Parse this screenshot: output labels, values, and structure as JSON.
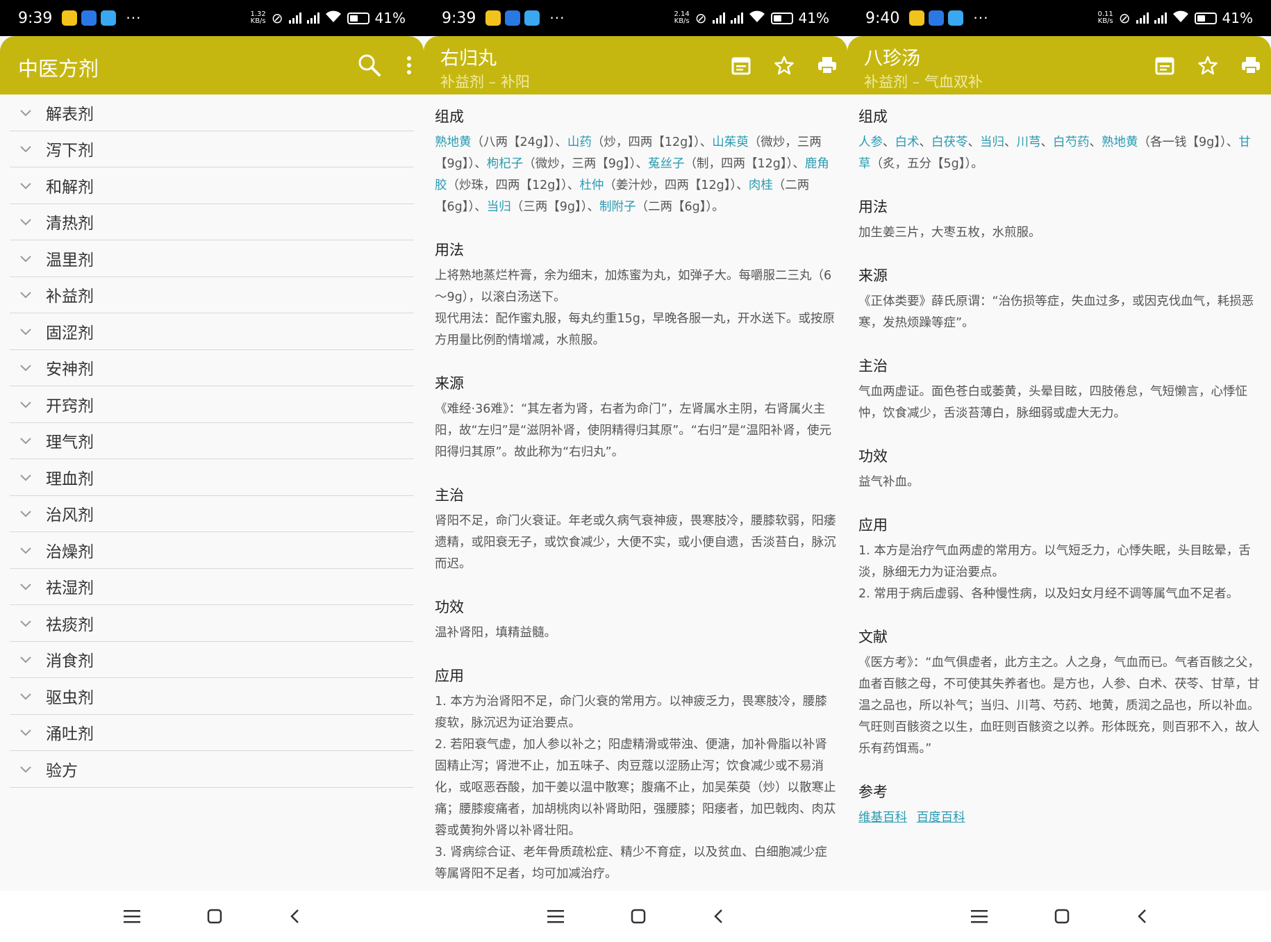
{
  "panel1": {
    "status": {
      "time": "9:39",
      "speed": "1.32",
      "speed_unit": "KB/s",
      "battery": "41%"
    },
    "title": "中医方剂",
    "categories": [
      "解表剂",
      "泻下剂",
      "和解剂",
      "清热剂",
      "温里剂",
      "补益剂",
      "固涩剂",
      "安神剂",
      "开窍剂",
      "理气剂",
      "理血剂",
      "治风剂",
      "治燥剂",
      "祛湿剂",
      "祛痰剂",
      "消食剂",
      "驱虫剂",
      "涌吐剂",
      "验方"
    ]
  },
  "panel2": {
    "status": {
      "time": "9:39",
      "speed": "2.14",
      "speed_unit": "KB/s",
      "battery": "41%"
    },
    "title": "右归丸",
    "subtitle": "补益剂 – 补阳",
    "composition": {
      "heading": "组成",
      "parts": [
        {
          "herb": "熟地黄",
          "text": "（八两【24g】）、"
        },
        {
          "herb": "山药",
          "text": "（炒，四两【12g】）、"
        },
        {
          "herb": "山茱萸",
          "text": "（微炒，三两【9g】）、"
        },
        {
          "herb": "枸杞子",
          "text": "（微炒，三两【9g】）、"
        },
        {
          "herb": "菟丝子",
          "text": "（制，四两【12g】）、"
        },
        {
          "herb": "鹿角胶",
          "text": "（炒珠，四两【12g】）、"
        },
        {
          "herb": "杜仲",
          "text": "（姜汁炒，四两【12g】）、"
        },
        {
          "herb": "肉桂",
          "text": "（二两【6g】）、"
        },
        {
          "herb": "当归",
          "text": "（三两【9g】）、"
        },
        {
          "herb": "制附子",
          "text": "（二两【6g】）。"
        }
      ]
    },
    "usage": {
      "heading": "用法",
      "text1": "上将熟地蒸烂杵膏，余为细末，加炼蜜为丸，如弹子大。每嚼服二三丸（6～9g），以滚白汤送下。",
      "text2": "现代用法：配作蜜丸服，每丸约重15g，早晚各服一丸，开水送下。或按原方用量比例酌情增减，水煎服。"
    },
    "source": {
      "heading": "来源",
      "text": "《难经·36难》：“其左者为肾，右者为命门”，左肾属水主阴，右肾属火主阳，故“左归”是“滋阴补肾，使阴精得归其原”。“右归”是“温阳补肾，使元阳得归其原”。故此称为“右归丸”。"
    },
    "indication": {
      "heading": "主治",
      "text": "肾阳不足，命门火衰证。年老或久病气衰神疲，畏寒肢冷，腰膝软弱，阳痿遗精，或阳衰无子，或饮食减少，大便不实，或小便自遗，舌淡苔白，脉沉而迟。"
    },
    "efficacy": {
      "heading": "功效",
      "text": "温补肾阳，填精益髓。"
    },
    "application": {
      "heading": "应用",
      "items": [
        "1. 本方为治肾阳不足，命门火衰的常用方。以神疲乏力，畏寒肢冷，腰膝痠软，脉沉迟为证治要点。",
        "2. 若阳衰气虚，加人参以补之；阳虚精滑或带浊、便溏，加补骨脂以补肾固精止泻；肾泄不止，加五味子、肉豆蔻以涩肠止泻；饮食减少或不易消化，或呕恶吞酸，加干姜以温中散寒；腹痛不止，加吴茱萸（炒）以散寒止痛；腰膝痠痛者，加胡桃肉以补肾助阳，强腰膝；阳痿者，加巴戟肉、肉苁蓉或黄狗外肾以补肾壮阳。",
        "3. 肾病综合证、老年骨质疏松症、精少不育症，以及贫血、白细胞减少症等属肾阳不足者，均可加减治疗。"
      ]
    }
  },
  "panel3": {
    "status": {
      "time": "9:40",
      "speed": "0.11",
      "speed_unit": "KB/s",
      "battery": "41%"
    },
    "title": "八珍汤",
    "subtitle": "补益剂 – 气血双补",
    "composition": {
      "heading": "组成",
      "herbs": [
        "人参",
        "白术",
        "白茯苓",
        "当归",
        "川芎",
        "白芍药",
        "熟地黄"
      ],
      "herbs_tail": "（各一钱【9g】）、",
      "herb2": "甘草",
      "herb2_tail": "（炙，五分【5g】）。"
    },
    "usage": {
      "heading": "用法",
      "text": "加生姜三片，大枣五枚，水煎服。"
    },
    "source": {
      "heading": "来源",
      "text": "《正体类要》薛氏原谓：“治伤损等症，失血过多，或因克伐血气，耗损恶寒，发热烦躁等症”。"
    },
    "indication": {
      "heading": "主治",
      "text": "气血两虚证。面色苍白或萎黄，头晕目眩，四肢倦怠，气短懒言，心悸怔忡，饮食减少，舌淡苔薄白，脉细弱或虚大无力。"
    },
    "efficacy": {
      "heading": "功效",
      "text": "益气补血。"
    },
    "application": {
      "heading": "应用",
      "items": [
        "1. 本方是治疗气血两虚的常用方。以气短乏力，心悸失眠，头目眩晕，舌淡，脉细无力为证治要点。",
        "2. 常用于病后虚弱、各种慢性病，以及妇女月经不调等属气血不足者。"
      ]
    },
    "literature": {
      "heading": "文献",
      "text": "《医方考》：“血气俱虚者，此方主之。人之身，气血而已。气者百骸之父，血者百骸之母，不可使其失养者也。是方也，人参、白术、茯苓、甘草，甘温之品也，所以补气；当归、川芎、芍药、地黄，质润之品也，所以补血。气旺则百骸资之以生，血旺则百骸资之以养。形体既充，则百邪不入，故人乐有药饵焉。”"
    },
    "reference": {
      "heading": "参考",
      "links": [
        "维基百科",
        "百度百科"
      ]
    }
  },
  "icons": {
    "search": "search-icon",
    "more": "more-vert-icon",
    "calendar": "calendar-icon",
    "star": "star-icon",
    "print": "print-icon"
  },
  "colors": {
    "appbar": "#c5b710",
    "herb_link": "#2a9bb2",
    "subtitle": "#f1eaa4"
  }
}
